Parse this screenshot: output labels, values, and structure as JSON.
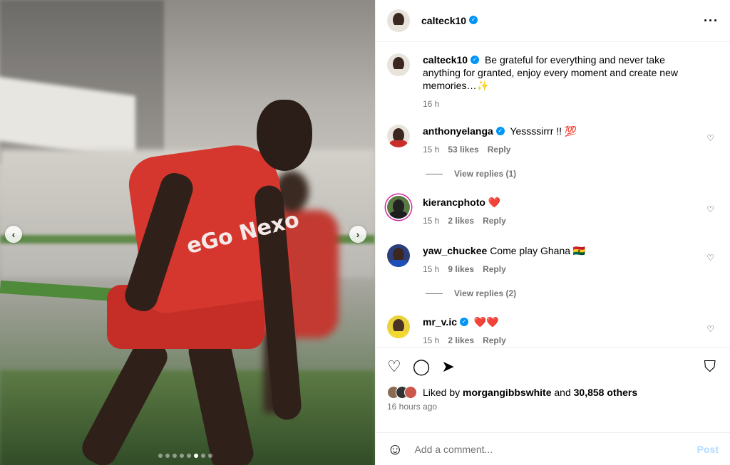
{
  "post": {
    "author": "calteck10",
    "caption": "Be grateful for everything and never take anything for granted, enjoy every moment and create new memories…✨",
    "caption_time": "16 h",
    "media": {
      "sponsor_text": "eGo Nexo",
      "slide_count": 8,
      "active_slide": 6
    }
  },
  "header": {
    "username": "calteck10",
    "more_icon": "more-horizontal-icon"
  },
  "comments": [
    {
      "username": "anthonyelanga",
      "verified": true,
      "text": "Yessssirrr !! 💯",
      "time": "15 h",
      "likes": "53 likes",
      "reply": "Reply",
      "view_replies": "View replies (1)",
      "avatar_color": "#e8e3dc"
    },
    {
      "username": "kierancphoto",
      "verified": false,
      "text": "❤️",
      "time": "15 h",
      "likes": "2 likes",
      "reply": "Reply",
      "avatar_color": "#5a7a44"
    },
    {
      "username": "yaw_chuckee",
      "verified": false,
      "text": "Come play Ghana 🇬🇭",
      "time": "15 h",
      "likes": "9 likes",
      "reply": "Reply",
      "view_replies": "View replies (2)",
      "avatar_color": "#2c3f7a"
    },
    {
      "username": "mr_v.ic",
      "verified": true,
      "text": "❤️❤️",
      "time": "15 h",
      "likes": "2 likes",
      "reply": "Reply",
      "avatar_color": "#e9d23a"
    }
  ],
  "actions": {
    "like_icon": "heart-icon",
    "comment_icon": "comment-icon",
    "share_icon": "share-icon",
    "save_icon": "bookmark-icon"
  },
  "likes": {
    "prefix": "Liked by",
    "user": "morgangibbswhite",
    "and": "and",
    "count": "30,858 others"
  },
  "posted_ago": "16 hours ago",
  "add_comment": {
    "placeholder": "Add a comment...",
    "post_label": "Post"
  },
  "colors": {
    "verified": "#0095f6",
    "meta": "#737373",
    "post_disabled": "#b3dbff"
  }
}
